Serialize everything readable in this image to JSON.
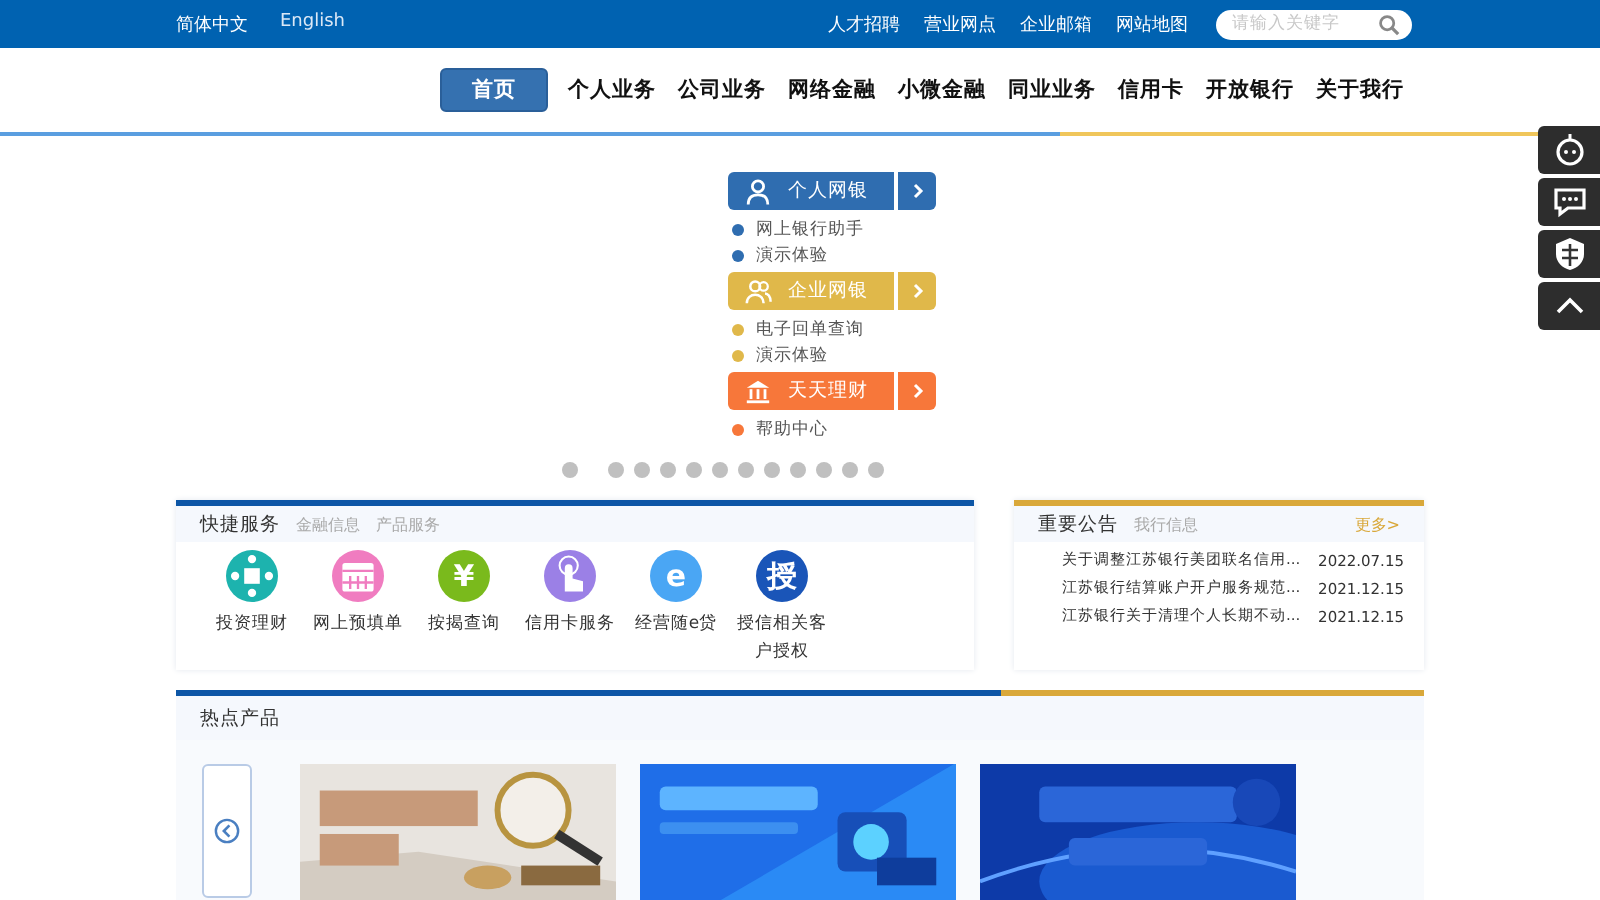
{
  "top_bar": {
    "languages": [
      {
        "label": "简体中文",
        "selected": true
      },
      {
        "label": "English",
        "selected": false
      }
    ],
    "links": [
      "人才招聘",
      "营业网点",
      "企业邮箱",
      "网站地图"
    ],
    "search": {
      "placeholder": "请输入关键字"
    }
  },
  "nav": [
    {
      "label": "首页",
      "selected": true
    },
    {
      "label": "个人业务",
      "selected": false
    },
    {
      "label": "公司业务",
      "selected": false
    },
    {
      "label": "网络金融",
      "selected": false
    },
    {
      "label": "小微金融",
      "selected": false
    },
    {
      "label": "同业业务",
      "selected": false
    },
    {
      "label": "信用卡",
      "selected": false
    },
    {
      "label": "开放银行",
      "selected": false
    },
    {
      "label": "关于我行",
      "selected": false
    }
  ],
  "login_panel": [
    {
      "label": "个人网银",
      "color": "#2f6db0",
      "links": [
        "网上银行助手",
        "演示体验"
      ]
    },
    {
      "label": "企业网银",
      "color": "#e0b84a",
      "links": [
        "电子回单查询",
        "演示体验"
      ]
    },
    {
      "label": "天天理财",
      "color": "#f7773a",
      "links": [
        "帮助中心"
      ]
    }
  ],
  "carousel_dots": [
    {
      "selected": false
    },
    {
      "selected": false
    },
    {
      "selected": false
    },
    {
      "selected": false
    },
    {
      "selected": false
    },
    {
      "selected": false
    },
    {
      "selected": false
    },
    {
      "selected": false
    },
    {
      "selected": false
    },
    {
      "selected": false
    },
    {
      "selected": false
    },
    {
      "selected": false
    }
  ],
  "quick_services": {
    "tabs": [
      {
        "label": "快捷服务",
        "selected": true
      },
      {
        "label": "金融信息",
        "selected": false
      },
      {
        "label": "产品服务",
        "selected": false
      }
    ],
    "items": [
      {
        "label": "投资理财",
        "color": "#1db3ae"
      },
      {
        "label": "网上预填单",
        "color": "#f07cc0"
      },
      {
        "label": "按揭查询",
        "glyph": "¥",
        "color": "#7aba1c"
      },
      {
        "label": "信用卡服务",
        "color": "#9b80e6"
      },
      {
        "label": "经营随e贷",
        "glyph": "e",
        "color": "#4aa6f4"
      },
      {
        "label": "授信相关客户授权",
        "glyph": "授",
        "color": "#1a55b8"
      }
    ]
  },
  "notices": {
    "tabs": [
      {
        "label": "重要公告",
        "selected": true
      },
      {
        "label": "我行信息",
        "selected": false
      }
    ],
    "more": "更多>",
    "rows": [
      {
        "title": "关于调整江苏银行美团联名信用...",
        "date": "2022.07.15"
      },
      {
        "title": "江苏银行结算账户开户服务规范...",
        "date": "2021.12.15"
      },
      {
        "title": "江苏银行关于清理个人长期不动...",
        "date": "2021.12.15"
      }
    ]
  },
  "hot_products": {
    "title": "热点产品"
  }
}
